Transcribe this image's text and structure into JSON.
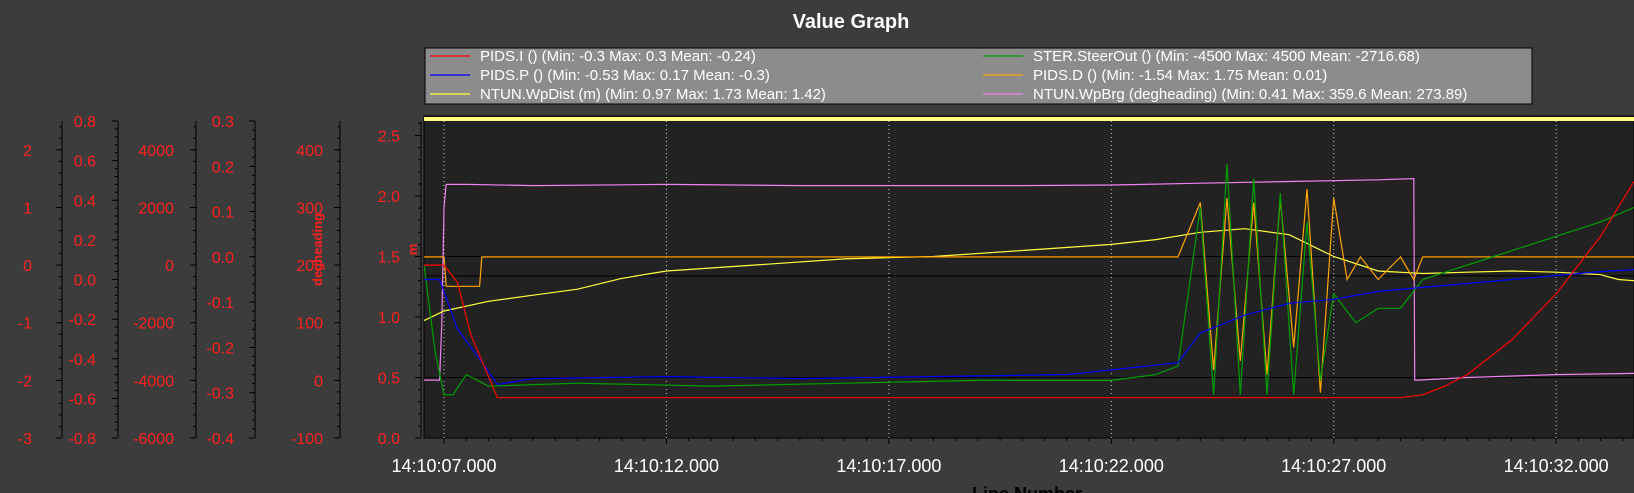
{
  "window": {
    "title": "Value Graph",
    "xlabel": "Line Number"
  },
  "legend": {
    "entries": [
      {
        "label": "PIDS.I () (Min: -0.3 Max: 0.3 Mean: -0.24)",
        "color": "#ff0000"
      },
      {
        "label": "STER.SteerOut () (Min: -4500 Max: 4500 Mean: -2716.68)",
        "color": "#00a000"
      },
      {
        "label": "PIDS.P () (Min: -0.53 Max: 0.17 Mean: -0.3)",
        "color": "#0000ff"
      },
      {
        "label": "PIDS.D () (Min: -1.54 Max: 1.75 Mean: 0.01)",
        "color": "#ffa500"
      },
      {
        "label": "NTUN.WpDist (m) (Min: 0.97 Max: 1.73 Mean: 1.42)",
        "color": "#ffff40"
      },
      {
        "label": "NTUN.WpBrg (degheading) (Min: 0.41 Max: 359.6 Mean: 273.89)",
        "color": "#ee82ee"
      }
    ]
  },
  "colors": {
    "background": "#3c3c3c",
    "plot_bg": "#222222",
    "axis_text": "#ff2020",
    "legend_bg": "#8c8c8c",
    "highlight": "#ffff80"
  },
  "chart_data": {
    "type": "line",
    "title": "Value Graph",
    "xlabel": "Line Number",
    "x_ticks": [
      "14:10:07.000",
      "14:10:12.000",
      "14:10:17.000",
      "14:10:22.000",
      "14:10:27.000",
      "14:10:32.000"
    ],
    "xlim_seconds_after_14_10_00": [
      6.55,
      33.75
    ],
    "grid": true,
    "legend_position": "top",
    "axes": [
      {
        "id": "a1",
        "ylim": [
          -3,
          2.5
        ],
        "ticks": [
          "-3",
          "-2",
          "-1",
          "0",
          "1",
          "2"
        ],
        "label": ""
      },
      {
        "id": "a2",
        "ylim": [
          -0.8,
          0.8
        ],
        "ticks": [
          "-0.8",
          "-0.6",
          "-0.4",
          "-0.2",
          "0.0",
          "0.2",
          "0.4",
          "0.6",
          "0.8"
        ],
        "label": ""
      },
      {
        "id": "a3",
        "ylim": [
          -6000,
          5000
        ],
        "ticks": [
          "-6000",
          "-4000",
          "-2000",
          "0",
          "2000",
          "4000"
        ],
        "label": ""
      },
      {
        "id": "a4",
        "ylim": [
          -0.4,
          0.3
        ],
        "ticks": [
          "-0.4",
          "-0.3",
          "-0.2",
          "-0.1",
          "0.0",
          "0.1",
          "0.2",
          "0.3"
        ],
        "label": ""
      },
      {
        "id": "a5",
        "ylim": [
          -100,
          450
        ],
        "ticks": [
          "-100",
          "0",
          "100",
          "200",
          "300",
          "400"
        ],
        "label": "degheading"
      },
      {
        "id": "a6",
        "ylim": [
          0,
          2.62
        ],
        "ticks": [
          "0.0",
          "0.5",
          "1.0",
          "1.5",
          "2.0",
          "2.5"
        ],
        "label": "m"
      }
    ],
    "series": [
      {
        "name": "NTUN.WpBrg (degheading)",
        "axis": "a5",
        "color": "#ee82ee",
        "x": [
          6.55,
          6.9,
          6.95,
          7.0,
          7.05,
          7.5,
          9,
          12,
          15,
          18,
          20,
          22,
          24,
          26,
          28,
          28.8,
          28.82,
          28.9,
          30,
          32,
          33.75
        ],
        "y": [
          0.41,
          0.41,
          100,
          300,
          340,
          340,
          338,
          340,
          338,
          338,
          338,
          339,
          342,
          345,
          348,
          350,
          0.41,
          0.41,
          5,
          10,
          12
        ]
      },
      {
        "name": "NTUN.WpDist (m)",
        "axis": "a6",
        "color": "#ffff40",
        "x": [
          6.55,
          7,
          8,
          9,
          10,
          11,
          12,
          14,
          16,
          18,
          20,
          22,
          23,
          24,
          25,
          26,
          27,
          28,
          29,
          30,
          31,
          32,
          33,
          33.4,
          33.75
        ],
        "y": [
          0.97,
          1.05,
          1.13,
          1.18,
          1.23,
          1.32,
          1.38,
          1.43,
          1.48,
          1.5,
          1.55,
          1.6,
          1.64,
          1.7,
          1.73,
          1.68,
          1.5,
          1.38,
          1.36,
          1.37,
          1.38,
          1.37,
          1.35,
          1.31,
          1.3
        ]
      },
      {
        "name": "PIDS.D ()",
        "axis": "a4",
        "color": "#ffa500",
        "x": [
          6.55,
          7.0,
          7.05,
          7.8,
          7.85,
          9,
          12,
          15,
          18,
          21,
          23.5,
          24.0,
          24.3,
          24.6,
          24.9,
          25.2,
          25.5,
          25.8,
          26.1,
          26.4,
          26.7,
          27.0,
          27.3,
          27.6,
          28,
          28.5,
          28.8,
          29,
          31,
          33.75
        ],
        "y": [
          0.0,
          0.0,
          -0.065,
          -0.065,
          0.0,
          0.0,
          0.0,
          0.0,
          0.0,
          0.0,
          0.0,
          0.12,
          -0.25,
          0.13,
          -0.23,
          0.12,
          -0.26,
          0.13,
          -0.2,
          0.15,
          -0.3,
          0.13,
          -0.05,
          0.0,
          -0.05,
          0.0,
          -0.05,
          0.0,
          0.0,
          0.0
        ]
      },
      {
        "name": "STER.SteerOut ()",
        "axis": "a3",
        "color": "#00a000",
        "x": [
          6.55,
          6.8,
          7.0,
          7.2,
          7.5,
          8,
          10,
          13,
          16,
          19,
          22,
          23,
          23.5,
          24,
          24.3,
          24.6,
          24.9,
          25.2,
          25.5,
          25.8,
          26.1,
          26.4,
          26.7,
          27,
          27.5,
          28,
          28.5,
          29,
          30,
          31,
          32,
          33,
          33.75
        ],
        "y": [
          0,
          -3000,
          -4500,
          -4500,
          -3800,
          -4200,
          -4100,
          -4200,
          -4100,
          -4000,
          -4000,
          -3800,
          -3500,
          2000,
          -4500,
          3500,
          -4500,
          3000,
          -4500,
          2500,
          -4500,
          1500,
          -4000,
          -1000,
          -2000,
          -1500,
          -1500,
          -500,
          0,
          500,
          1000,
          1500,
          2000
        ]
      },
      {
        "name": "PIDS.P ()",
        "axis": "a2",
        "color": "#0000ff",
        "x": [
          6.55,
          6.9,
          7.3,
          7.8,
          8.2,
          9,
          12,
          15,
          18,
          21,
          23.5,
          24,
          25,
          26,
          27,
          28,
          29,
          30,
          31,
          32,
          33,
          33.75
        ],
        "y": [
          0.0,
          0.0,
          -0.25,
          -0.4,
          -0.53,
          -0.5,
          -0.49,
          -0.5,
          -0.49,
          -0.48,
          -0.42,
          -0.27,
          -0.18,
          -0.12,
          -0.1,
          -0.06,
          -0.04,
          -0.02,
          0.0,
          0.02,
          0.04,
          0.05
        ]
      },
      {
        "name": "PIDS.I ()",
        "axis": "a1",
        "color": "#ff0000",
        "x": [
          6.55,
          7.0,
          7.3,
          7.6,
          8.2,
          9,
          12,
          15,
          18,
          21,
          24,
          27,
          28.5,
          29,
          29.5,
          30,
          31,
          32,
          33,
          33.75
        ],
        "y": [
          0.0,
          0.0,
          -0.3,
          -1.2,
          -2.3,
          -2.3,
          -2.3,
          -2.3,
          -2.3,
          -2.3,
          -2.3,
          -2.3,
          -2.3,
          -2.25,
          -2.1,
          -1.9,
          -1.3,
          -0.5,
          0.5,
          1.45
        ]
      }
    ]
  }
}
